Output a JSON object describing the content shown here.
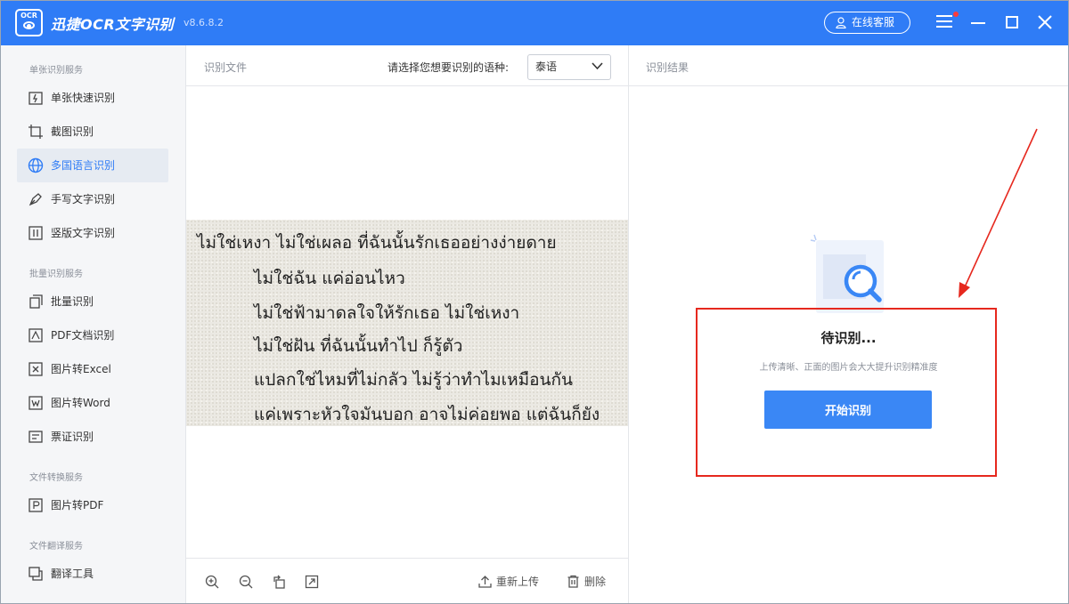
{
  "titlebar": {
    "app_title": "迅捷OCR文字识别",
    "version": "v8.6.8.2",
    "logo_text": "OCR",
    "online_service": "在线客服"
  },
  "sidebar": {
    "sections": [
      {
        "title": "单张识别服务"
      },
      {
        "title": "批量识别服务"
      },
      {
        "title": "文件转换服务"
      },
      {
        "title": "文件翻译服务"
      }
    ],
    "items": [
      {
        "label": "单张快速识别",
        "icon": "quick-scan-icon"
      },
      {
        "label": "截图识别",
        "icon": "crop-icon"
      },
      {
        "label": "多国语言识别",
        "icon": "globe-icon",
        "active": true
      },
      {
        "label": "手写文字识别",
        "icon": "pen-icon"
      },
      {
        "label": "竖版文字识别",
        "icon": "vertical-text-icon"
      },
      {
        "label": "批量识别",
        "icon": "batch-icon"
      },
      {
        "label": "PDF文档识别",
        "icon": "pdf-icon"
      },
      {
        "label": "图片转Excel",
        "icon": "excel-icon"
      },
      {
        "label": "图片转Word",
        "icon": "word-icon"
      },
      {
        "label": "票证识别",
        "icon": "ticket-icon"
      },
      {
        "label": "图片转PDF",
        "icon": "pdf-convert-icon"
      },
      {
        "label": "翻译工具",
        "icon": "translate-icon"
      }
    ]
  },
  "middle": {
    "title": "识别文件",
    "language_label": "请选择您想要识别的语种:",
    "language_value": "泰语",
    "preview_lines": [
      "ไม่ใช่เหงา ไม่ใช่เผลอ ที่ฉันนั้นรักเธออย่างง่ายดาย",
      "ไม่ใช่ฉัน แค่อ่อนไหว",
      "ไม่ใช่ฟ้ามาดลใจให้รักเธอ ไม่ใช่เหงา",
      "ไม่ใช่ฝัน ที่ฉันนั้นทำไป ก็รู้ตัว",
      "แปลกใช่ไหมที่ไม่กลัว ไม่รู้ว่าทำไมเหมือนกัน",
      "แค่เพราะหัวใจมันบอก อาจไม่ค่อยพอ แต่ฉันก็ยัง"
    ],
    "reupload": "重新上传",
    "delete": "删除"
  },
  "right": {
    "title": "识别结果",
    "pending_title": "待识别...",
    "pending_hint": "上传清晰、正面的图片会大大提升识别精准度",
    "start_button": "开始识别"
  },
  "colors": {
    "brand": "#2f7cf6",
    "annotation": "#e6281e"
  }
}
